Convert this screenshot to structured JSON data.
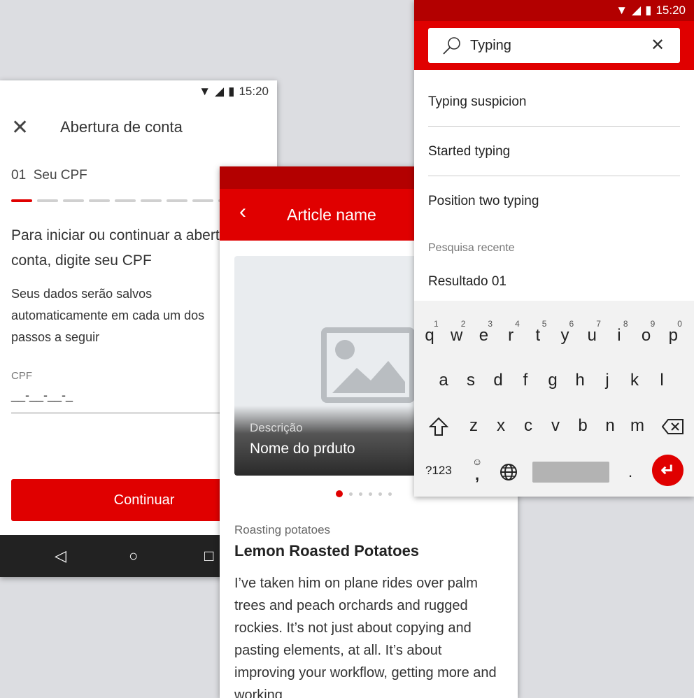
{
  "screen1": {
    "time": "15:20",
    "title": "Abertura de conta",
    "step_number": "01",
    "step_label": "Seu CPF",
    "steps_total": 9,
    "steps_done": 1,
    "heading": "Para iniciar ou continuar a abertura da sua conta, digite seu CPF",
    "body": "Seus dados serão salvos automaticamente em cada um dos passos a seguir",
    "cpf_label": "CPF",
    "cpf_placeholder": "__-__-__-_",
    "continue_label": "Continuar"
  },
  "screen2": {
    "title": "Article name",
    "image_caption": "Descrição",
    "image_title": "Nome do prduto",
    "carousel_count": 6,
    "carousel_active": 1,
    "category": "Roasting potatoes",
    "headline": "Lemon Roasted Potatoes",
    "body": "I’ve taken him on plane rides over palm trees and peach orchards and rugged rockies. It’s not just about copying and pasting elements, at all. It’s about improving your workflow, getting more and working"
  },
  "screen3": {
    "time": "15:20",
    "search_value": "Typing",
    "suggestions": [
      "Typing suspicion",
      "Started typing",
      "Position two typing"
    ],
    "recent_label": "Pesquisa recente",
    "recent": [
      "Resultado 01"
    ],
    "keyboard": {
      "row1": [
        "q",
        "w",
        "e",
        "r",
        "t",
        "y",
        "u",
        "i",
        "o",
        "p"
      ],
      "row1_nums": [
        "1",
        "2",
        "3",
        "4",
        "5",
        "6",
        "7",
        "8",
        "9",
        "0"
      ],
      "row2": [
        "a",
        "s",
        "d",
        "f",
        "g",
        "h",
        "j",
        "k",
        "l"
      ],
      "row3": [
        "z",
        "x",
        "c",
        "v",
        "b",
        "n",
        "m"
      ],
      "symbols_label": "?123",
      "comma": ",",
      "period": "."
    }
  },
  "colors": {
    "brand_red": "#e00000",
    "status_red": "#b30000"
  }
}
